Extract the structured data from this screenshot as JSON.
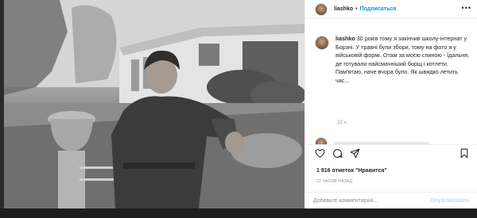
{
  "post": {
    "username": "liashko",
    "separator": "•",
    "follow_label": "Подписаться",
    "more_icon": "more-horizontal-icon",
    "caption_text": "30 років тому я закінчив школу-інтернат у Борзні. У травні були збори, тому на фото я у військовій формі. Отам за моєю спиною - Їдальня, де готували найсмачніший борщ і котлети. Пам'ятаю, наче вчора було. Як швидко летить час...",
    "caption_time": "22 ч.",
    "likes_text": "1 816 отметок \"Нравится\"",
    "posted_ago": "22 ЧАСОВ НАЗАД",
    "comment_placeholder": "Добавьте комментарий...",
    "publish_label": "Опубликовать"
  },
  "icons": [
    "heart-icon",
    "comment-icon",
    "share-icon",
    "bookmark-icon"
  ],
  "colors": {
    "accent": "#0095f6",
    "publish_disabled": "#b2dffc",
    "muted": "#8e8e8e"
  }
}
